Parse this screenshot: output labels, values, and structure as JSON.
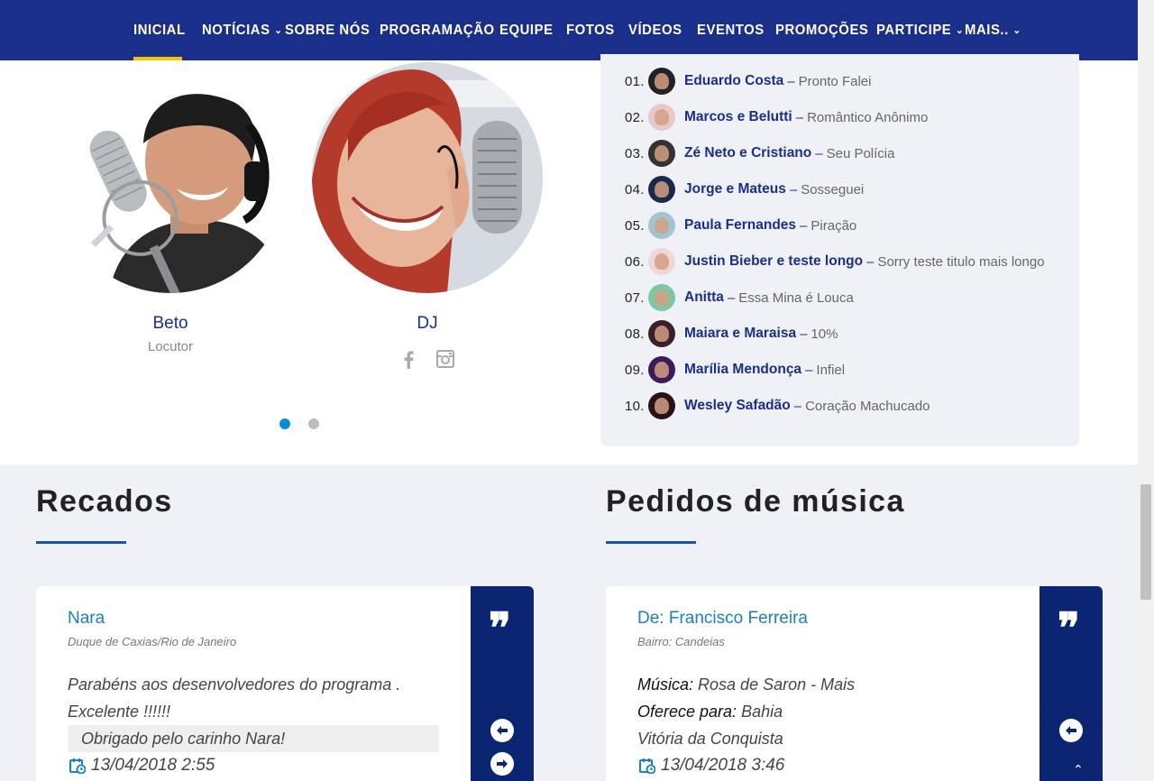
{
  "nav": {
    "items": [
      {
        "label": "INICIAL",
        "chevron": false
      },
      {
        "label": "NOTÍCIAS",
        "chevron": true
      },
      {
        "label": "SOBRE NÓS",
        "chevron": false
      },
      {
        "label": "PROGRAMAÇÃO",
        "chevron": false
      },
      {
        "label": "EQUIPE",
        "chevron": false
      },
      {
        "label": "FOTOS",
        "chevron": false
      },
      {
        "label": "VÍDEOS",
        "chevron": false
      },
      {
        "label": "EVENTOS",
        "chevron": false
      },
      {
        "label": "PROMOÇÕES",
        "chevron": false
      },
      {
        "label": "PARTICIPE",
        "chevron": true
      },
      {
        "label": "MAIS..",
        "chevron": true
      }
    ],
    "active": "INICIAL",
    "colors": {
      "bar": "#1a2f8a",
      "active_underline": "#f5c400"
    }
  },
  "presenters": [
    {
      "name": "Beto",
      "role": "Locutor"
    },
    {
      "name": "DJ",
      "role": ""
    }
  ],
  "carousel": {
    "pages": 2,
    "active_page": 1
  },
  "top10": [
    {
      "rank": "01.",
      "artist": "Eduardo Costa",
      "song": "Pronto Falei"
    },
    {
      "rank": "02.",
      "artist": "Marcos e Belutti",
      "song": "Romântico Anônimo"
    },
    {
      "rank": "03.",
      "artist": "Zé Neto e Cristiano",
      "song": "Seu Polícia"
    },
    {
      "rank": "04.",
      "artist": "Jorge e Mateus",
      "song": "Sosseguei"
    },
    {
      "rank": "05.",
      "artist": "Paula Fernandes",
      "song": "Piração"
    },
    {
      "rank": "06.",
      "artist": "Justin Bieber e teste longo",
      "song": "Sorry teste titulo mais longo"
    },
    {
      "rank": "07.",
      "artist": "Anitta",
      "song": "Essa Mina é Louca"
    },
    {
      "rank": "08.",
      "artist": "Maiara e Maraisa",
      "song": "10%"
    },
    {
      "rank": "09.",
      "artist": "Marília Mendonça",
      "song": "Infiel"
    },
    {
      "rank": "10.",
      "artist": "Wesley Safadão",
      "song": "Coração Machucado"
    }
  ],
  "sep": "–",
  "recados": {
    "title": "Recados",
    "author": "Nara",
    "location": "Duque de Caxias/Rio de Janeiro",
    "message_line1": "Parabéns aos desenvolvedores do programa .",
    "message_line2": "Excelente !!!!!!",
    "reply": "Obrigado pelo carinho Nara!",
    "date": "13/04/2018 2:55"
  },
  "pedidos": {
    "title": "Pedidos de música",
    "from": "De: Francisco Ferreira",
    "bairro": "Bairro: Candeias",
    "musica_label": "Música:",
    "musica_value": "Rosa de Saron - Mais",
    "oferece_label": "Oferece para:",
    "oferece_value": "Bahia",
    "city": "Vitória da Conquista",
    "date": "13/04/2018 3:46"
  },
  "quote_mark": "❞"
}
